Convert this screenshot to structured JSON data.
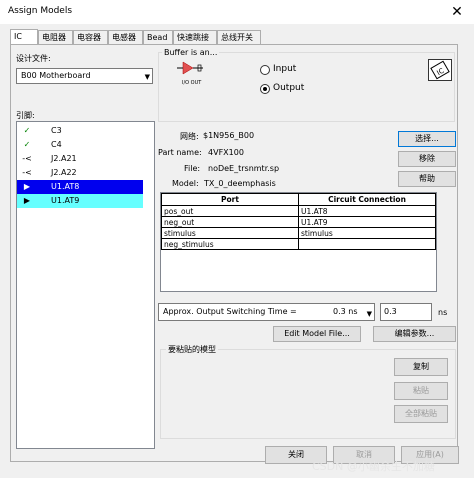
{
  "window": {
    "title": "Assign Models",
    "close": "✕"
  },
  "tabs": [
    "IC",
    "电阻器",
    "电容器",
    "电感器",
    "Bead",
    "快速跳接",
    "总线开关"
  ],
  "design_file": {
    "label": "设计文件:",
    "value": "B00 Motherboard"
  },
  "pins": {
    "label": "引脚:",
    "items": [
      {
        "icon": "check-icon",
        "glyph": "✓",
        "name": "C3"
      },
      {
        "icon": "check-icon",
        "glyph": "✓",
        "name": "C4"
      },
      {
        "icon": "input-pin-icon",
        "glyph": "-<",
        "name": "J2.A21"
      },
      {
        "icon": "input-pin-icon",
        "glyph": "-<",
        "name": "J2.A22"
      },
      {
        "icon": "output-pin-icon",
        "glyph": "▶",
        "name": "U1.AT8"
      },
      {
        "icon": "output-pin-icon",
        "glyph": "▶",
        "name": "U1.AT9"
      }
    ]
  },
  "buffer": {
    "label": "Buffer is an...",
    "symbol_text": "I/O OUT",
    "options": [
      {
        "label": "Input",
        "checked": false
      },
      {
        "label": "Output",
        "checked": true
      }
    ]
  },
  "info": {
    "net_label": "网络:",
    "net_value": "$1N956_B00",
    "part_label": "Part name:",
    "part_value": "4VFX100",
    "file_label": "File:",
    "file_value": "noDeE_trsnmtr.sp",
    "model_label": "Model:",
    "model_value": "TX_0_deemphasis"
  },
  "side_buttons": {
    "select": "选择...",
    "remove": "移除",
    "help": "帮助"
  },
  "port_table": {
    "headers": [
      "Port",
      "Circuit Connection"
    ],
    "rows": [
      [
        "pos_out",
        "U1.AT8"
      ],
      [
        "neg_out",
        "U1.AT9"
      ],
      [
        "stimulus",
        "stimulus"
      ],
      [
        "neg_stimulus",
        ""
      ]
    ]
  },
  "switching": {
    "label": "Approx. Output Switching Time =",
    "select_value": "0.3 ns",
    "edit_value": "0.3",
    "unit": "ns"
  },
  "model_buttons": {
    "edit_model": "Edit Model File...",
    "edit_params": "编辑参数..."
  },
  "paste_group": {
    "label": "要粘贴的模型",
    "copy": "复制",
    "paste": "粘贴",
    "paste_all": "全部粘贴"
  },
  "footer": {
    "close": "关闭",
    "cancel": "取消",
    "apply": "应用(A)"
  },
  "watermark": "CSDN @小幽余生不加糖"
}
